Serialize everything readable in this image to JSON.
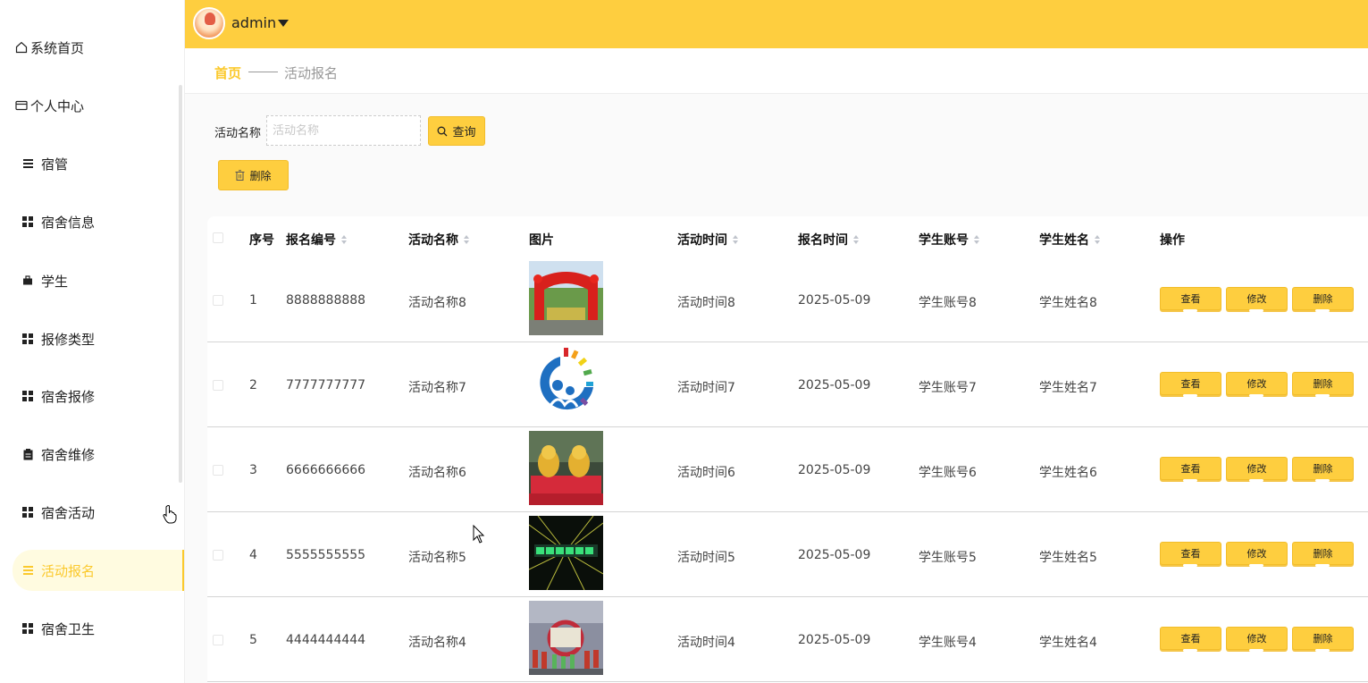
{
  "sidebar": {
    "items": [
      {
        "label": "系统首页",
        "icon": "home-icon"
      },
      {
        "label": "个人中心",
        "icon": "card-icon"
      },
      {
        "label": "宿管",
        "icon": "list-icon"
      },
      {
        "label": "宿舍信息",
        "icon": "grid-icon"
      },
      {
        "label": "学生",
        "icon": "briefcase-icon"
      },
      {
        "label": "报修类型",
        "icon": "grid-icon"
      },
      {
        "label": "宿舍报修",
        "icon": "grid-icon"
      },
      {
        "label": "宿舍维修",
        "icon": "clipboard-icon"
      },
      {
        "label": "宿舍活动",
        "icon": "grid-icon"
      },
      {
        "label": "活动报名",
        "icon": "list-icon"
      },
      {
        "label": "宿舍卫生",
        "icon": "grid-icon"
      }
    ],
    "active_index": 9
  },
  "header": {
    "username": "admin"
  },
  "breadcrumb": {
    "home": "首页",
    "current": "活动报名"
  },
  "search": {
    "label": "活动名称",
    "placeholder": "活动名称",
    "button_label": "查询"
  },
  "actions": {
    "delete_label": "删除"
  },
  "table": {
    "columns": [
      "序号",
      "报名编号",
      "活动名称",
      "图片",
      "活动时间",
      "报名时间",
      "学生账号",
      "学生姓名",
      "操作"
    ],
    "row_actions": {
      "view": "查看",
      "edit": "修改",
      "delete": "删除"
    },
    "rows": [
      {
        "index": "1",
        "code": "8888888888",
        "activity": "活动名称8",
        "time": "活动时间8",
        "signup_date": "2025-05-09",
        "student_account": "学生账号8",
        "student_name": "学生姓名8"
      },
      {
        "index": "2",
        "code": "7777777777",
        "activity": "活动名称7",
        "time": "活动时间7",
        "signup_date": "2025-05-09",
        "student_account": "学生账号7",
        "student_name": "学生姓名7"
      },
      {
        "index": "3",
        "code": "6666666666",
        "activity": "活动名称6",
        "time": "活动时间6",
        "signup_date": "2025-05-09",
        "student_account": "学生账号6",
        "student_name": "学生姓名6"
      },
      {
        "index": "4",
        "code": "5555555555",
        "activity": "活动名称5",
        "time": "活动时间5",
        "signup_date": "2025-05-09",
        "student_account": "学生账号5",
        "student_name": "学生姓名5"
      },
      {
        "index": "5",
        "code": "4444444444",
        "activity": "活动名称4",
        "time": "活动时间4",
        "signup_date": "2025-05-09",
        "student_account": "学生账号4",
        "student_name": "学生姓名4"
      }
    ]
  },
  "colors": {
    "accent": "#fece3f",
    "active_text": "#fbc92d",
    "active_bg": "#fffbe0"
  }
}
